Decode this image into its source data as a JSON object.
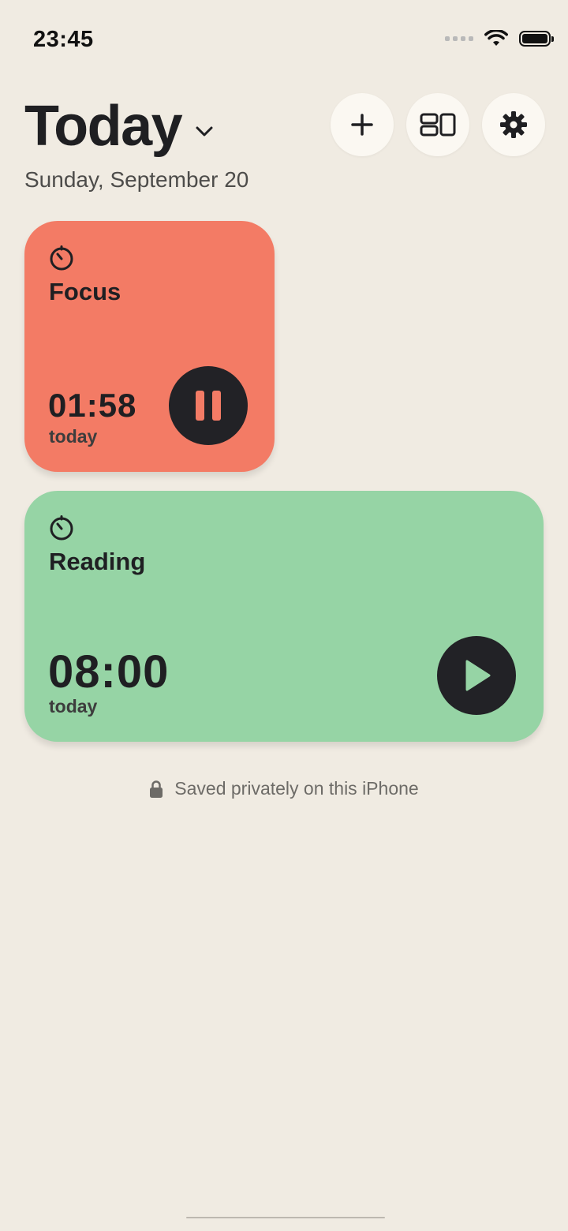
{
  "status_bar": {
    "time": "23:45",
    "icons": [
      "cellular-signal-icon",
      "wifi-icon",
      "battery-icon"
    ]
  },
  "header": {
    "title": "Today",
    "date": "Sunday, September 20",
    "actions": [
      {
        "name": "add-button",
        "icon": "plus-icon"
      },
      {
        "name": "layout-button",
        "icon": "layout-icon"
      },
      {
        "name": "settings-button",
        "icon": "gear-icon"
      }
    ]
  },
  "timers": [
    {
      "title": "Focus",
      "time": "01:58",
      "caption": "today",
      "state_icon": "pause-icon",
      "color": "#f37b65"
    },
    {
      "title": "Reading",
      "time": "08:00",
      "caption": "today",
      "state_icon": "play-icon",
      "color": "#96d4a5"
    }
  ],
  "footer": {
    "note": "Saved privately on this iPhone",
    "icon": "lock-icon"
  },
  "colors": {
    "background": "#f0ebe2",
    "button_bg": "#fbf8f2",
    "dark": "#222226"
  }
}
